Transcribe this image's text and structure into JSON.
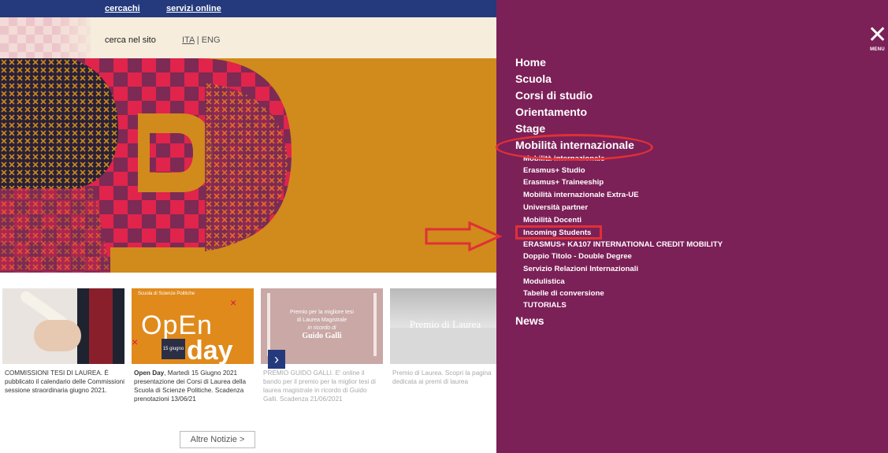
{
  "topbar": {
    "links": [
      "cercachi",
      "servizi online"
    ]
  },
  "header": {
    "search_label": "cerca nel sito",
    "lang_ita": "ITA",
    "lang_sep": " | ",
    "lang_eng": "ENG"
  },
  "news": {
    "cards": [
      {
        "title": "",
        "text": "COMMISSIONI TESI DI LAUREA. È pubblicato il calendario delle Commissioni sessione straordinaria giugno 2021."
      },
      {
        "title": "Open Day",
        "text": ", Martedì 15 Giugno 2021 presentazione dei Corsi di Laurea della Scuola di Scienze Politiche. Scadenza prenotazioni 13/06/21",
        "thumb_big": "OpEn",
        "thumb_day": "day",
        "thumb_date": "15 giugno",
        "thumb_small": "Scuola di Scienze Politiche"
      },
      {
        "title": "",
        "text": "PREMIO GUIDO GALLI. E' online il bando per il premio per la miglior tesi di laurea magistrale in ricordo di Guido Galli. Scadenza 21/06/2021",
        "thumb_line1": "Premio per la migliore tesi",
        "thumb_line2": "di Laurea Magistrale",
        "thumb_line3": "in ricordo di",
        "thumb_line4": "Guido Galli"
      },
      {
        "title": "",
        "text": "Premio di Laurea. Scopri la pagina dedicata ai premi di laurea",
        "thumb_text": "Premio di Laurea"
      }
    ],
    "next_arrow": "›",
    "more_button": "Altre Notizie  >"
  },
  "menu": {
    "close_icon": "close-icon",
    "close_label": "MENU",
    "items": [
      "Home",
      "Scuola",
      "Corsi di studio",
      "Orientamento",
      "Stage",
      "Mobilità internazionale"
    ],
    "subitems": [
      "Mobilità internazionale",
      "Erasmus+ Studio",
      "Erasmus+ Traineeship",
      "Mobilità internazionale Extra-UE",
      "Università partner",
      "Mobilità Docenti",
      "Incoming Students",
      "ERASMUS+ KA107 INTERNATIONAL CREDIT MOBILITY",
      "Doppio Titolo - Double Degree",
      "Servizio Relazioni Internazionali",
      "Modulistica",
      "Tabelle di conversione",
      "TUTORIALS"
    ],
    "last_item": "News"
  },
  "colors": {
    "menu_bg": "#7c2058",
    "highlight": "#e03036",
    "topbar": "#243a7c",
    "hero_bg": "#d18a1c"
  }
}
